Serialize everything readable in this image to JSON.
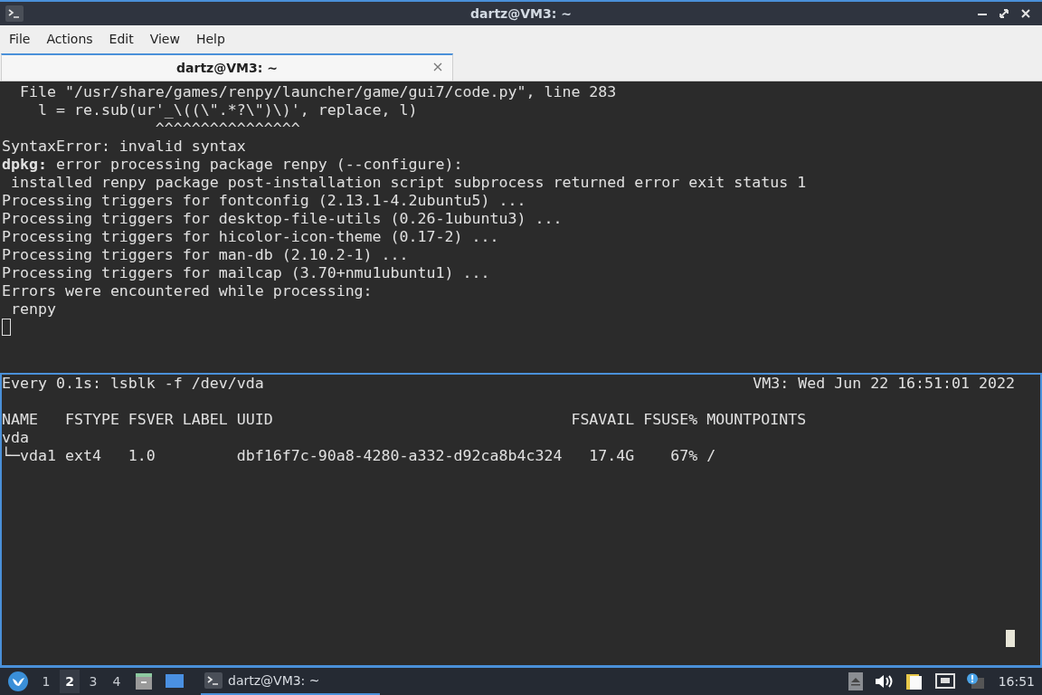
{
  "window": {
    "title": "dartz@VM3: ~"
  },
  "menu": [
    "File",
    "Actions",
    "Edit",
    "View",
    "Help"
  ],
  "tabs": [
    {
      "label": "dartz@VM3: ~",
      "selected": true
    }
  ],
  "panes": [
    {
      "focused": false,
      "lines": [
        "  File \"/usr/share/games/renpy/launcher/game/gui7/code.py\", line 283",
        "    l = re.sub(ur'_\\((\\\".*?\\\")\\)', replace, l)",
        "                 ^^^^^^^^^^^^^^^^",
        "SyntaxError: invalid syntax",
        "**dpkg:** error processing package renpy (--configure):",
        " installed renpy package post-installation script subprocess returned error exit status 1",
        "Processing triggers for fontconfig (2.13.1-4.2ubuntu5) ...",
        "Processing triggers for desktop-file-utils (0.26-1ubuntu3) ...",
        "Processing triggers for hicolor-icon-theme (0.17-2) ...",
        "Processing triggers for man-db (2.10.2-1) ...",
        "Processing triggers for mailcap (3.70+nmu1ubuntu1) ...",
        "Errors were encountered while processing:",
        " renpy"
      ]
    },
    {
      "focused": true,
      "header": {
        "left": "Every 0.1s: lsblk -f /dev/vda",
        "right": "VM3: Wed Jun 22 16:51:01 2022"
      },
      "lines": [
        "NAME   FSTYPE FSVER LABEL UUID                                 FSAVAIL FSUSE% MOUNTPOINTS",
        "vda",
        "└─vda1 ext4   1.0         dbf16f7c-90a8-4280-a332-d92ca8b4c324   17.4G    67% /"
      ]
    }
  ],
  "taskbar": {
    "workspaces": [
      {
        "label": "1",
        "selected": false
      },
      {
        "label": "2",
        "selected": true
      },
      {
        "label": "3",
        "selected": false
      },
      {
        "label": "4",
        "selected": false
      }
    ],
    "tasks": [
      {
        "label": "dartz@VM3: ~",
        "selected": true
      }
    ],
    "clock": "16:51"
  }
}
